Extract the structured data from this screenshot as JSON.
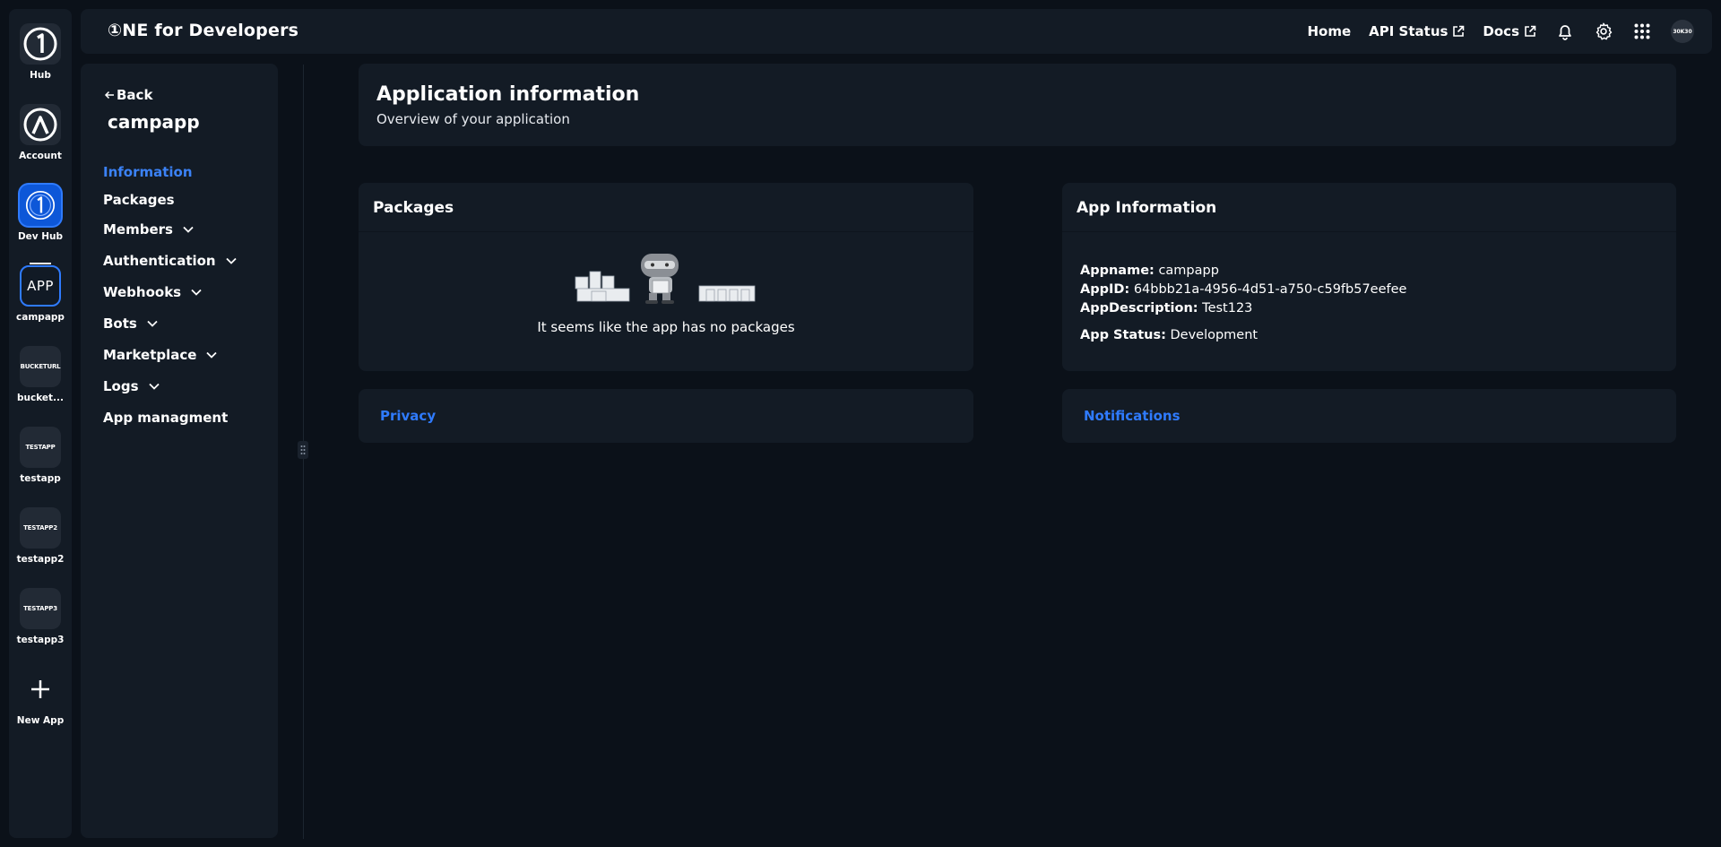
{
  "rail": {
    "items": [
      {
        "label": "Hub",
        "tile": ""
      },
      {
        "label": "Account",
        "tile": ""
      },
      {
        "label": "Dev Hub",
        "tile": ""
      },
      {
        "label": "campapp",
        "tile": "APP"
      },
      {
        "label": "bucket...",
        "tile": "BUCKETURL"
      },
      {
        "label": "testapp",
        "tile": "TESTAPP"
      },
      {
        "label": "testapp2",
        "tile": "TESTAPP2"
      },
      {
        "label": "testapp3",
        "tile": "TESTAPP3"
      },
      {
        "label": "New App",
        "tile": ""
      }
    ]
  },
  "topbar": {
    "brand": "①NE for Developers",
    "nav": {
      "home": "Home",
      "api_status": "API Status",
      "docs": "Docs"
    },
    "avatar": "30K30",
    "icons": [
      "external-link-icon",
      "bell-icon",
      "gear-icon",
      "apps-grid-icon"
    ]
  },
  "sidemenu": {
    "back": "Back",
    "app_name": "campapp",
    "items": [
      {
        "label": "Information"
      },
      {
        "label": "Packages"
      },
      {
        "label": "Members"
      },
      {
        "label": "Authentication"
      },
      {
        "label": "Webhooks"
      },
      {
        "label": "Bots"
      },
      {
        "label": "Marketplace"
      },
      {
        "label": "Logs"
      },
      {
        "label": "App managment"
      }
    ]
  },
  "main": {
    "header": {
      "title": "Application information",
      "subtitle": "Overview of your application"
    },
    "packages": {
      "title": "Packages",
      "empty_text": "It seems like the app has no packages"
    },
    "app_info": {
      "title": "App Information",
      "appname_label": "Appname:",
      "appname": "campapp",
      "appid_label": "AppID:",
      "appid": "64bbb21a-4956-4d51-a750-c59fb57eefee",
      "desc_label": "AppDescription:",
      "desc": "Test123",
      "status_label": "App Status:",
      "status": "Development"
    },
    "privacy": "Privacy",
    "notifications": "Notifications"
  },
  "colors": {
    "accent": "#2f7bff",
    "background": "#0b1119",
    "panel": "#131b25"
  }
}
